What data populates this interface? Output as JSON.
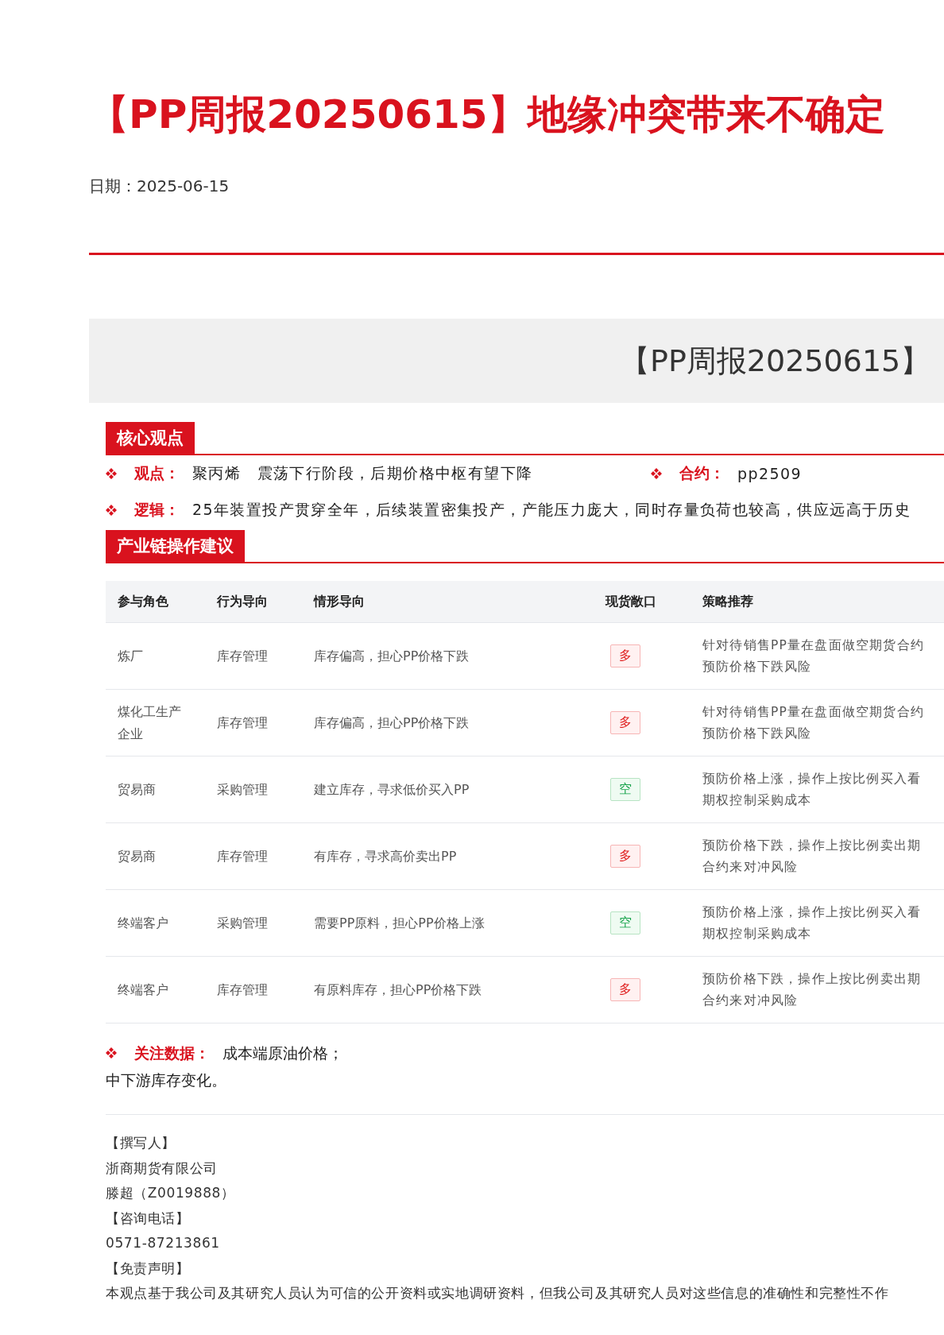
{
  "title": "【PP周报20250615】地缘冲突带来不确定",
  "date": "日期：2025-06-15",
  "banner_title": "【PP周报20250615】",
  "core_view": {
    "heading": "核心观点",
    "rows": [
      [
        {
          "label": "观点：",
          "text": "聚丙烯　震荡下行阶段，后期价格中枢有望下降"
        },
        {
          "label": "合约：",
          "text": "pp2509"
        }
      ],
      [
        {
          "label": "逻辑：",
          "text": "25年装置投产贯穿全年，后续装置密集投产，产能压力庞大，同时存量负荷也较高，供应远高于历史"
        }
      ]
    ]
  },
  "operations": {
    "heading": "产业链操作建议",
    "columns": [
      "参与角色",
      "行为导向",
      "情形导向",
      "现货敞口",
      "策略推荐"
    ],
    "rows": [
      {
        "role": "炼厂",
        "behavior": "库存管理",
        "situation": "库存偏高，担心PP价格下跌",
        "position": {
          "text": "多",
          "kind": "long"
        },
        "strategy": [
          "针对待销售PP量在盘面做空期货合约",
          "预防价格下跌风险"
        ]
      },
      {
        "role": "煤化工生产企业",
        "behavior": "库存管理",
        "situation": "库存偏高，担心PP价格下跌",
        "position": {
          "text": "多",
          "kind": "long"
        },
        "strategy": [
          "针对待销售PP量在盘面做空期货合约",
          "预防价格下跌风险"
        ]
      },
      {
        "role": "贸易商",
        "behavior": "采购管理",
        "situation": "建立库存，寻求低价买入PP",
        "position": {
          "text": "空",
          "kind": "short"
        },
        "strategy": [
          "预防价格上涨，操作上按比例买入看",
          "期权控制采购成本"
        ]
      },
      {
        "role": "贸易商",
        "behavior": "库存管理",
        "situation": "有库存，寻求高价卖出PP",
        "position": {
          "text": "多",
          "kind": "long"
        },
        "strategy": [
          "预防价格下跌，操作上按比例卖出期",
          "合约来对冲风险"
        ]
      },
      {
        "role": "终端客户",
        "behavior": "采购管理",
        "situation": "需要PP原料，担心PP价格上涨",
        "position": {
          "text": "空",
          "kind": "short"
        },
        "strategy": [
          "预防价格上涨，操作上按比例买入看",
          "期权控制采购成本"
        ]
      },
      {
        "role": "终端客户",
        "behavior": "库存管理",
        "situation": "有原料库存，担心PP价格下跌",
        "position": {
          "text": "多",
          "kind": "long"
        },
        "strategy": [
          "预防价格下跌，操作上按比例卖出期",
          "合约来对冲风险"
        ]
      }
    ]
  },
  "watch_data": {
    "label": "关注数据：",
    "lines": [
      "成本端原油价格；",
      "中下游库存变化。"
    ]
  },
  "footer": [
    "【撰写人】",
    "浙商期货有限公司",
    "滕超（Z0019888）",
    "【咨询电话】",
    "0571-87213861",
    "【免责声明】",
    "本观点基于我公司及其研究人员认为可信的公开资料或实地调研资料，但我公司及其研究人员对这些信息的准确性和完整性不作"
  ]
}
